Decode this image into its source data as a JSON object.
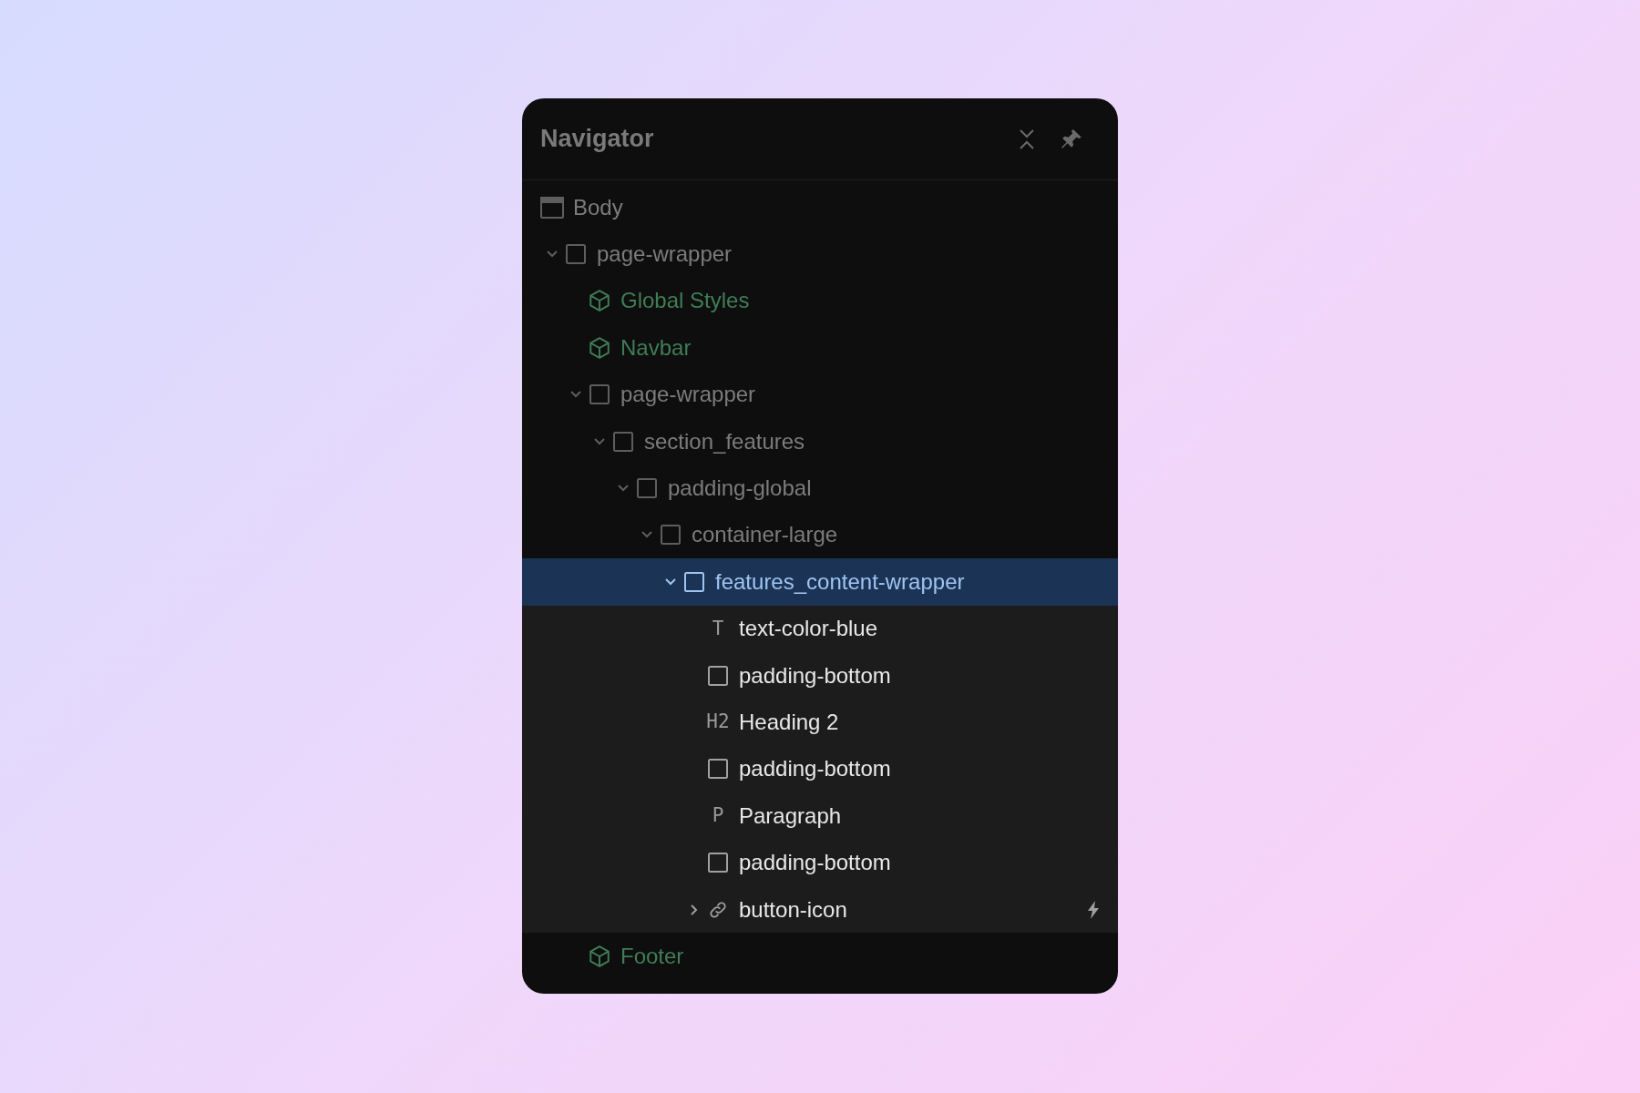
{
  "panel": {
    "title": "Navigator"
  },
  "tree": [
    {
      "label": "Body",
      "kind": "body",
      "selected": false
    },
    {
      "label": "page-wrapper",
      "kind": "div",
      "selected": false,
      "expanded": true,
      "children": [
        {
          "label": "Global Styles",
          "kind": "component",
          "selected": false
        },
        {
          "label": "Navbar",
          "kind": "component",
          "selected": false
        },
        {
          "label": "page-wrapper",
          "kind": "div",
          "selected": false,
          "expanded": true,
          "children": [
            {
              "label": "section_features",
              "kind": "div",
              "selected": false,
              "expanded": true,
              "children": [
                {
                  "label": "padding-global",
                  "kind": "div",
                  "selected": false,
                  "expanded": true,
                  "children": [
                    {
                      "label": "container-large",
                      "kind": "div",
                      "selected": false,
                      "expanded": true,
                      "children": [
                        {
                          "label": "features_content-wrapper",
                          "kind": "div",
                          "selected": true,
                          "expanded": true,
                          "children": [
                            {
                              "label": "text-color-blue",
                              "kind": "text",
                              "tag": "T",
                              "selected": false
                            },
                            {
                              "label": "padding-bottom",
                              "kind": "div",
                              "selected": false
                            },
                            {
                              "label": "Heading 2",
                              "kind": "text",
                              "tag": "H2",
                              "selected": false
                            },
                            {
                              "label": "padding-bottom",
                              "kind": "div",
                              "selected": false
                            },
                            {
                              "label": "Paragraph",
                              "kind": "text",
                              "tag": "P",
                              "selected": false
                            },
                            {
                              "label": "padding-bottom",
                              "kind": "div",
                              "selected": false
                            },
                            {
                              "label": "button-icon",
                              "kind": "link",
                              "selected": false,
                              "expanded": false,
                              "interaction": true
                            }
                          ]
                        }
                      ]
                    }
                  ]
                }
              ]
            }
          ]
        },
        {
          "label": "Footer",
          "kind": "component",
          "selected": false
        }
      ]
    }
  ]
}
